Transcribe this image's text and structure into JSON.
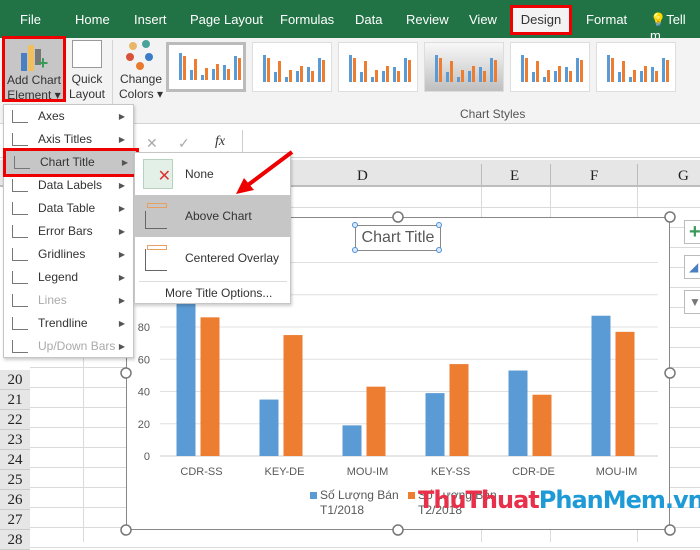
{
  "tabs": [
    "File",
    "Home",
    "Insert",
    "Page Layout",
    "Formulas",
    "Data",
    "Review",
    "View",
    "Design",
    "Format"
  ],
  "tell_me": "Tell m",
  "ribbon": {
    "add_chart_element": [
      "Add Chart",
      "Element ▾"
    ],
    "quick_layout": [
      "Quick",
      "Layout ▾"
    ],
    "change_colors": [
      "Change",
      "Colors ▾"
    ],
    "chart_styles_label": "Chart Styles"
  },
  "formula_bar": {
    "cancel": "✕",
    "enter": "✓",
    "fx": "fx"
  },
  "columns": [
    "D",
    "E",
    "F",
    "G"
  ],
  "rows": [
    "20",
    "21",
    "22",
    "23",
    "24",
    "25",
    "26",
    "27",
    "28"
  ],
  "menu": {
    "items": [
      {
        "label": "Axes",
        "enabled": true
      },
      {
        "label": "Axis Titles",
        "enabled": true
      },
      {
        "label": "Chart Title",
        "enabled": true,
        "highlighted": true
      },
      {
        "label": "Data Labels",
        "enabled": true
      },
      {
        "label": "Data Table",
        "enabled": true
      },
      {
        "label": "Error Bars",
        "enabled": true
      },
      {
        "label": "Gridlines",
        "enabled": true
      },
      {
        "label": "Legend",
        "enabled": true
      },
      {
        "label": "Lines",
        "enabled": false
      },
      {
        "label": "Trendline",
        "enabled": true
      },
      {
        "label": "Up/Down Bars",
        "enabled": false
      }
    ]
  },
  "submenu": {
    "items": [
      "None",
      "Above Chart",
      "Centered Overlay"
    ],
    "highlighted": "Above Chart",
    "more": "More Title Options..."
  },
  "colors": {
    "ribbon_green": "#217346",
    "series1": "#5b9bd5",
    "series2": "#ed7d31",
    "highlight_border": "#e00000"
  },
  "chart_data": {
    "type": "bar",
    "title": "Chart Title",
    "categories": [
      "CDR-SS",
      "KEY-DE",
      "MOU-IM",
      "KEY-SS",
      "CDR-DE",
      "MOU-IM"
    ],
    "series": [
      {
        "name": "Số Lượng Bán T1/2018",
        "values": [
          96,
          35,
          19,
          39,
          53,
          87
        ]
      },
      {
        "name": "Số Lượng Bán T2/2018",
        "values": [
          86,
          75,
          43,
          57,
          38,
          77
        ]
      }
    ],
    "yticks": [
      0,
      20,
      40,
      60,
      80
    ],
    "ylim": [
      0,
      120
    ],
    "grid": true,
    "legend": "bottom"
  },
  "watermark": {
    "part1": "ThuThuat",
    "part2": "PhanMem.vn"
  }
}
